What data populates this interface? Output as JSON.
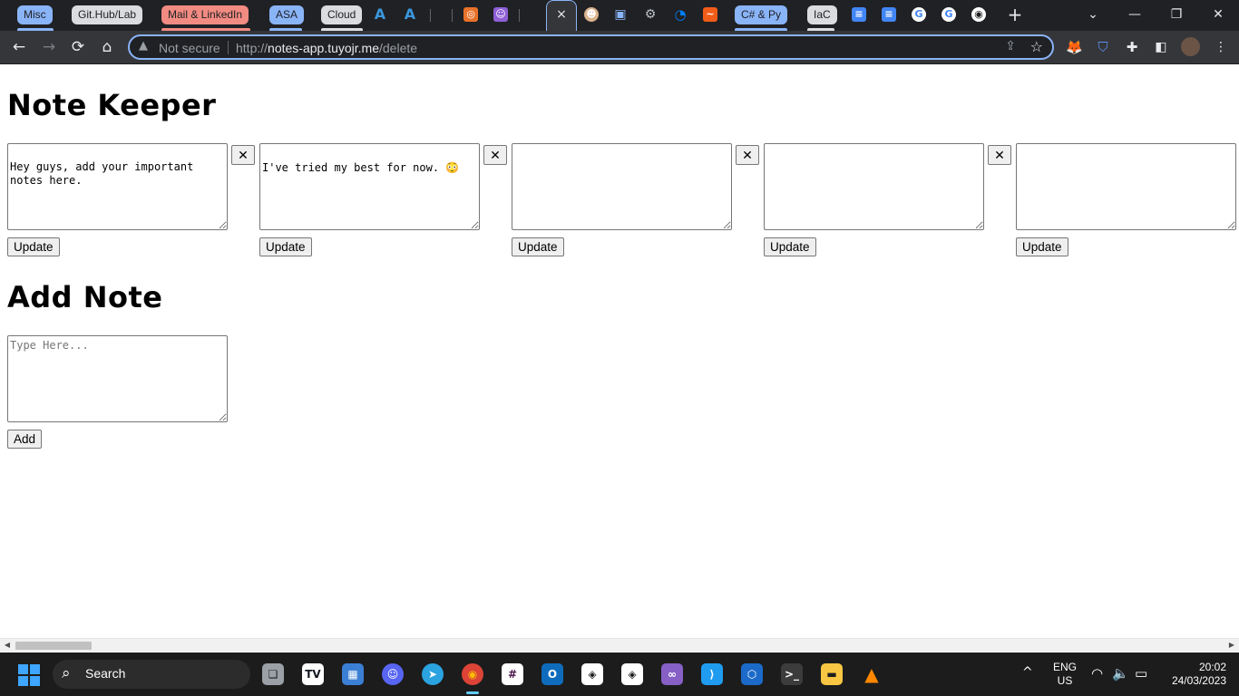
{
  "tabstrip": {
    "groups": [
      {
        "label": "Misc",
        "color": "#8ab4f8"
      },
      {
        "label": "Git.Hub/Lab",
        "color": "#dadce0"
      },
      {
        "label": "Mail & LinkedIn",
        "color": "#f28b82"
      },
      {
        "label": "ASA",
        "color": "#8ab4f8"
      },
      {
        "label": "Cloud",
        "color": "#dadce0"
      },
      {
        "label": "C# & Py",
        "color": "#8ab4f8"
      },
      {
        "label": "IaC",
        "color": "#dadce0"
      }
    ],
    "active_tab_close": "×",
    "new_tab": "+",
    "window_controls": {
      "dropdown": "⌄",
      "minimize": "—",
      "restore": "❐",
      "close": "✕"
    }
  },
  "toolbar": {
    "back": "←",
    "forward": "→",
    "reload": "⟳",
    "home": "⌂",
    "security_label": "Not secure",
    "url_scheme": "http://",
    "url_host": "notes-app.tuyojr.me",
    "url_path": "/delete"
  },
  "page": {
    "title": "Note Keeper",
    "notes": [
      {
        "text": "Hey guys, add your important notes here.",
        "delete_label": "✕",
        "update_label": "Update"
      },
      {
        "text": "I've tried my best for now. 😳",
        "delete_label": "✕",
        "update_label": "Update"
      },
      {
        "text": "",
        "delete_label": "✕",
        "update_label": "Update"
      },
      {
        "text": "",
        "delete_label": "✕",
        "update_label": "Update"
      },
      {
        "text": "",
        "update_label": "Update"
      }
    ],
    "add_section": {
      "title": "Add Note",
      "placeholder": "Type Here...",
      "add_label": "Add"
    }
  },
  "taskbar": {
    "search_label": "Search",
    "language_top": "ENG",
    "language_bottom": "US",
    "time": "20:02",
    "date": "24/03/2023"
  }
}
